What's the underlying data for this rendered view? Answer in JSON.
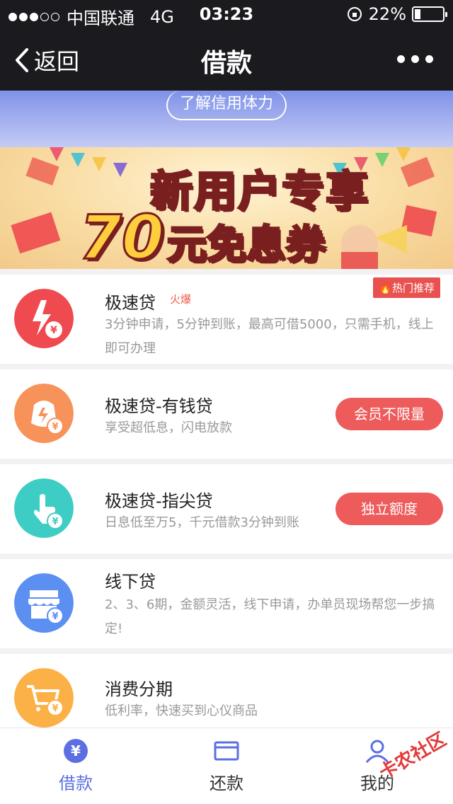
{
  "status_bar": {
    "carrier": "中国联通",
    "network": "4G",
    "time": "03:23",
    "battery": "22%"
  },
  "nav": {
    "back_label": "返回",
    "title": "借款"
  },
  "hero": {
    "pill_label": "了解信用体力"
  },
  "banner": {
    "line1": "新用户专享",
    "line2_num": "70",
    "line2_rest": "元免息券"
  },
  "products": [
    {
      "title": "极速贷",
      "badge": "火爆",
      "tag": "热门推荐",
      "desc": "3分钟申请，5分钟到账，最高可借5000，只需手机，线上即可办理",
      "icon": "lightning-yen-icon",
      "color": "#ef4a4f"
    },
    {
      "title": "极速贷-有钱贷",
      "desc": "享受超低息，闪电放款",
      "cta": "会员不限量",
      "icon": "money-bag-yen-icon",
      "color": "#f7925a"
    },
    {
      "title": "极速贷-指尖贷",
      "desc": "日息低至万5，千元借款3分钟到账",
      "cta": "独立额度",
      "icon": "finger-tap-yen-icon",
      "color": "#3ecdc4"
    },
    {
      "title": "线下贷",
      "desc": "2、3、6期，金额灵活，线下申请，办单员现场帮您一步搞定!",
      "icon": "store-yen-icon",
      "color": "#5b8ff2"
    },
    {
      "title": "消费分期",
      "desc": "低利率，快速买到心仪商品",
      "icon": "cart-yen-icon",
      "color": "#fbb146"
    }
  ],
  "tabbar": {
    "tabs": [
      {
        "label": "借款",
        "icon": "yen-coin-icon",
        "active": true
      },
      {
        "label": "还款",
        "icon": "card-icon",
        "active": false
      },
      {
        "label": "我的",
        "icon": "user-icon",
        "active": false
      }
    ]
  },
  "watermark": "卡农社区",
  "colors": {
    "accent": "#5b6fe3",
    "cta": "#ee5b5b"
  }
}
